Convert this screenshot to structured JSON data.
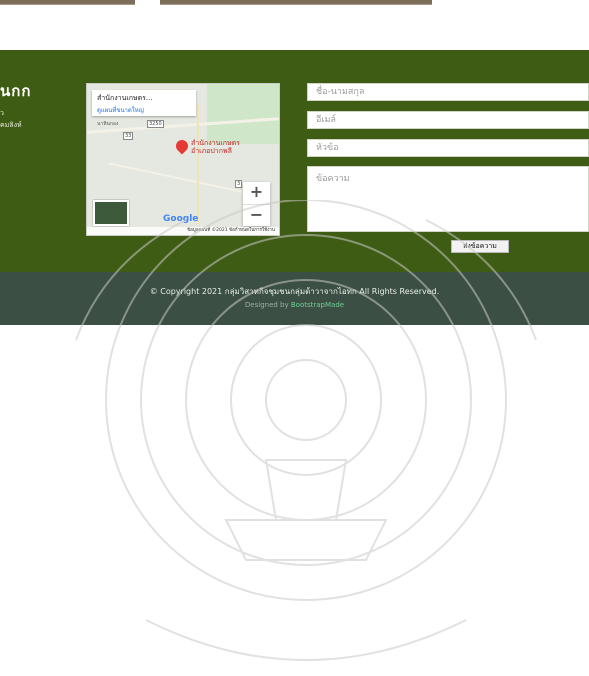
{
  "contact": {
    "title": "นกก",
    "line1": "ว",
    "line2": "คมลิงห์"
  },
  "map": {
    "place_name": "สำนักงานเกษตร...",
    "view_larger": "ดูแผนที่ขนาดใหญ่",
    "pin_label_1": "สำนักงานเกษตร",
    "pin_label_2": "อำเภอปากพลี",
    "zoom_in": "+",
    "zoom_out": "−",
    "logo": "Google",
    "footer": "ข้อมูลแผนที่ ©2021   ข้อกำหนดในการใช้งาน",
    "tags": [
      "3250",
      "33",
      "3"
    ],
    "place_labels": [
      "นาหินกอง"
    ]
  },
  "form": {
    "name_placeholder": "ชื่อ-นามสกุล",
    "email_placeholder": "อีเมล์",
    "subject_placeholder": "หัวข้อ",
    "message_placeholder": "ข้อความ",
    "send_label": "ส่งข้อความ"
  },
  "footer": {
    "copyright": "© Copyright 2021 กลุ่มวิสาหกิจชุมชนกลุ่มต้าวาจากไอทก All Rights Reserved.",
    "designed_prefix": "Designed by ",
    "designed_link": "BootstrapMade"
  },
  "colors": {
    "contact_bg": "#3f5c14",
    "footer_bg": "#3b4f44",
    "pin": "#e53935",
    "link": "#1a73e8"
  }
}
